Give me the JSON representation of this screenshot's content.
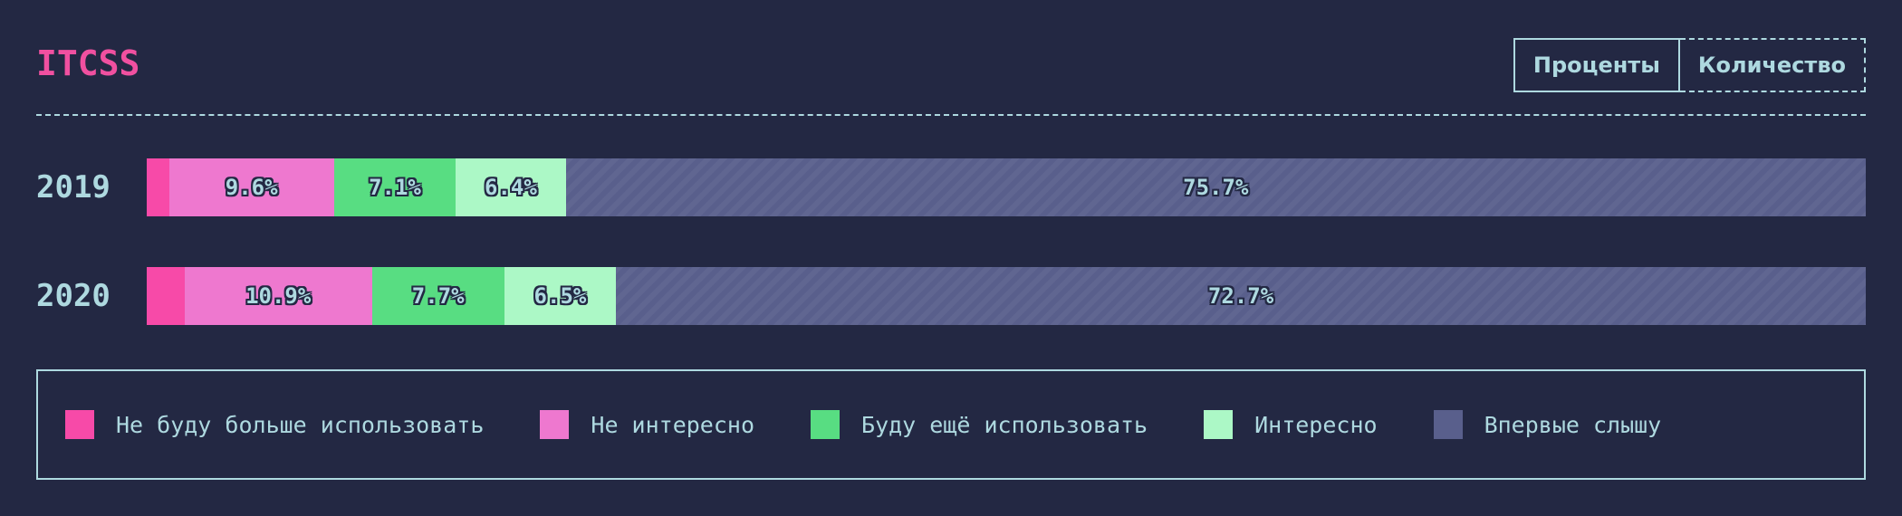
{
  "header": {
    "title": "ITCSS",
    "toggle": {
      "percent_label": "Проценты",
      "count_label": "Количество",
      "active": "percent"
    }
  },
  "colors": {
    "background": "#232843",
    "text": "#aed9e0",
    "title": "#f050a0"
  },
  "chart_data": {
    "type": "bar",
    "stacked": true,
    "orientation": "horizontal",
    "categories": [
      "2019",
      "2020"
    ],
    "series": [
      {
        "name": "Не буду больше использовать",
        "color": "#f74aa8",
        "values": [
          1.3,
          2.2
        ],
        "show_label": [
          false,
          false
        ],
        "labels": [
          "",
          ""
        ]
      },
      {
        "name": "Не интересно",
        "color": "#ee78cf",
        "values": [
          9.6,
          10.9
        ],
        "show_label": [
          true,
          true
        ],
        "labels": [
          "9.6%",
          "10.9%"
        ]
      },
      {
        "name": "Буду ещё использовать",
        "color": "#58dd82",
        "values": [
          7.1,
          7.7
        ],
        "show_label": [
          true,
          true
        ],
        "labels": [
          "7.1%",
          "7.7%"
        ]
      },
      {
        "name": "Интересно",
        "color": "#acf8c6",
        "values": [
          6.4,
          6.5
        ],
        "show_label": [
          true,
          true
        ],
        "labels": [
          "6.4%",
          "6.5%"
        ]
      },
      {
        "name": "Впервые слышу",
        "color": "#595f8c",
        "values": [
          75.7,
          72.7
        ],
        "show_label": [
          true,
          true
        ],
        "labels": [
          "75.7%",
          "72.7%"
        ],
        "pattern": "diagonal-stripes"
      }
    ],
    "unit": "%",
    "legend": {
      "placement": "bottom"
    }
  }
}
